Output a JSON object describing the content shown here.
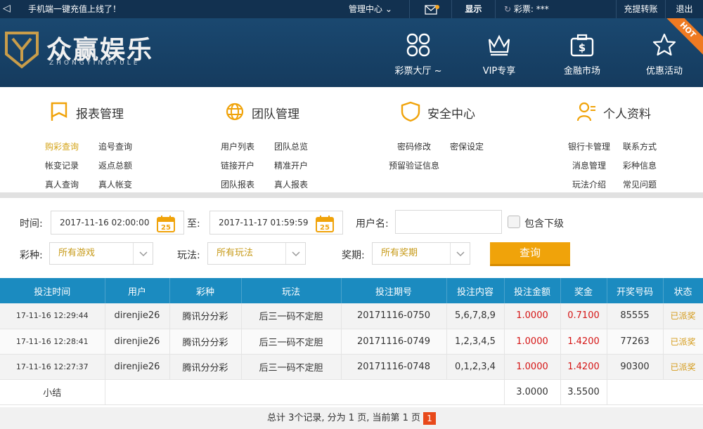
{
  "topbar": {
    "notice": "手机端一键充值上线了！",
    "manage": "管理中心",
    "show": "显示",
    "lottery_label": "彩票: ***",
    "recharge": "充提转账",
    "logout": "退出"
  },
  "brand": {
    "title": "众赢娱乐",
    "subtitle": "ZHONGYINGYULE"
  },
  "nav": [
    {
      "label": "彩票大厅 ~",
      "icon": "grid-icon"
    },
    {
      "label": "VIP专享",
      "icon": "crown-icon"
    },
    {
      "label": "金融市场",
      "icon": "money-bag-icon"
    },
    {
      "label": "优惠活动",
      "icon": "star-icon"
    }
  ],
  "hot": "HOT",
  "menu": {
    "report": {
      "title": "报表管理",
      "links": [
        "购彩查询",
        "追号查询",
        "帐变记录",
        "返点总额",
        "真人查询",
        "真人帐变"
      ]
    },
    "team": {
      "title": "团队管理",
      "links": [
        "用户列表",
        "团队总览",
        "链接开户",
        "精准开户",
        "团队报表",
        "真人报表"
      ]
    },
    "security": {
      "title": "安全中心",
      "links": [
        "密码修改",
        "密保设定",
        "预留验证信息"
      ]
    },
    "profile": {
      "title": "个人资料",
      "links": [
        "银行卡管理",
        "联系方式",
        "消息管理",
        "彩种信息",
        "玩法介绍",
        "常见问题"
      ]
    }
  },
  "filters": {
    "time_label": "时间:",
    "start": "2017-11-16 02:00:00",
    "to_label": "至:",
    "end": "2017-11-17 01:59:59",
    "calendar_day": "25",
    "username_label": "用户名:",
    "username_value": "",
    "include_sub": "包含下级",
    "lottery_label": "彩种:",
    "lottery_value": "所有游戏",
    "play_label": "玩法:",
    "play_value": "所有玩法",
    "period_label": "奖期:",
    "period_value": "所有奖期",
    "query": "查询"
  },
  "table": {
    "headers": [
      "投注时间",
      "用户",
      "彩种",
      "玩法",
      "投注期号",
      "投注内容",
      "投注金额",
      "奖金",
      "开奖号码",
      "状态"
    ],
    "rows": [
      [
        "17-11-16 12:29:44",
        "direnjie26",
        "腾讯分分彩",
        "后三一码不定胆",
        "20171116-0750",
        "5,6,7,8,9",
        "1.0000",
        "0.7100",
        "85555",
        "已派奖"
      ],
      [
        "17-11-16 12:28:41",
        "direnjie26",
        "腾讯分分彩",
        "后三一码不定胆",
        "20171116-0749",
        "1,2,3,4,5",
        "1.0000",
        "1.4200",
        "77263",
        "已派奖"
      ],
      [
        "17-11-16 12:27:37",
        "direnjie26",
        "腾讯分分彩",
        "后三一码不定胆",
        "20171116-0748",
        "0,1,2,3,4",
        "1.0000",
        "1.4200",
        "90300",
        "已派奖"
      ]
    ],
    "summary": {
      "label": "小结",
      "amount": "3.0000",
      "prize": "3.5500"
    }
  },
  "pager": {
    "text": "总计 3个记录, 分为 1 页, 当前第 1 页",
    "current": "1"
  }
}
